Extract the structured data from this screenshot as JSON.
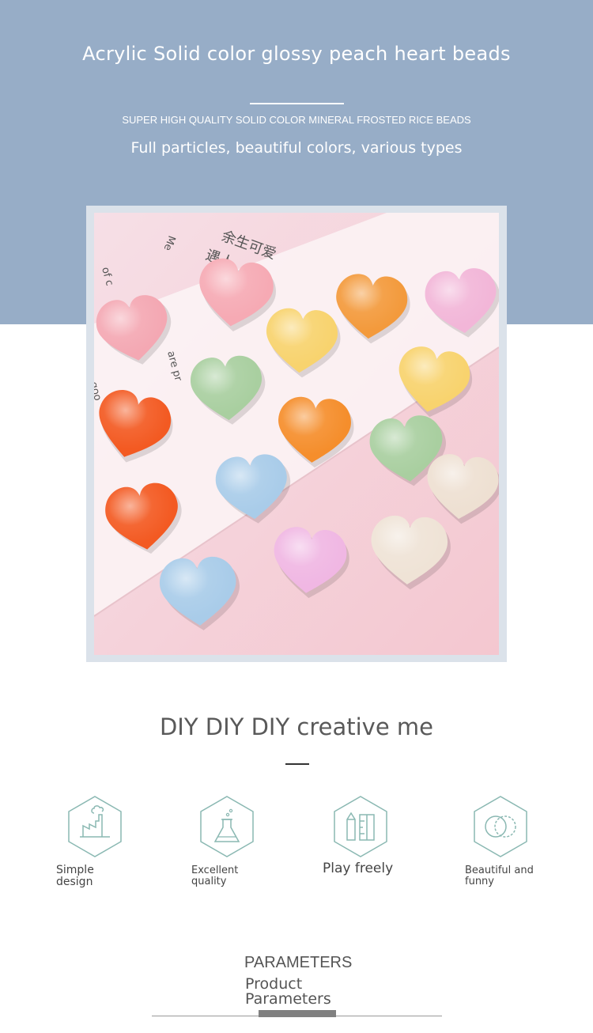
{
  "hero": {
    "title": "Acrylic Solid color glossy peach heart beads",
    "subtitle": "SUPER HIGH QUALITY SOLID COLOR MINERAL FROSTED RICE BEADS",
    "tagline": "Full particles, beautiful colors, various types",
    "background_color": "#97adc7"
  },
  "photo": {
    "overlay_text": [
      "余生可爱",
      "遇人",
      "Me",
      "of c",
      "are pr",
      "goo"
    ]
  },
  "features_section": {
    "title": "DIY DIY DIY creative me",
    "items": [
      {
        "icon": "factory-icon",
        "label_line1": "Simple",
        "label_line2": "design"
      },
      {
        "icon": "flask-icon",
        "label_line1": "Excellent",
        "label_line2": "quality"
      },
      {
        "icon": "ruler-pencil-icon",
        "label_line1": "Play freely",
        "label_line2": ""
      },
      {
        "icon": "rings-icon",
        "label_line1": "Beautiful and",
        "label_line2": "funny"
      }
    ],
    "icon_color": "#8ab8b2"
  },
  "parameters": {
    "heading": "PARAMETERS",
    "subheading": "Product Parameters"
  }
}
